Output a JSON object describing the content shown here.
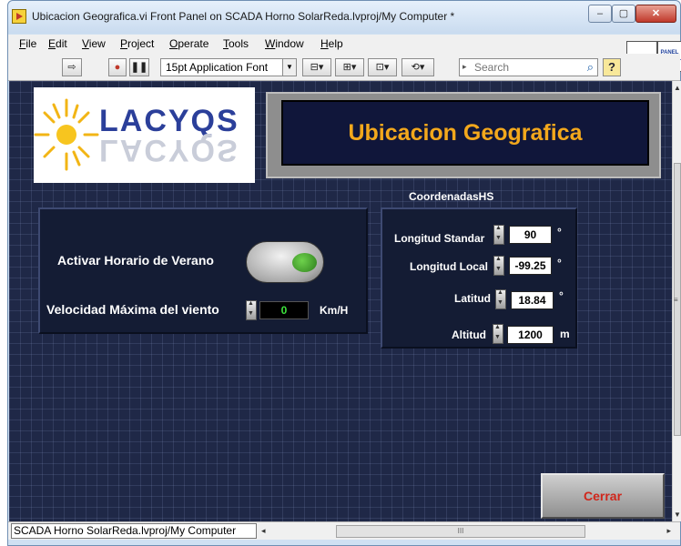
{
  "window": {
    "title": "Ubicacion Geografica.vi Front Panel on SCADA Horno SolarReda.lvproj/My Computer *",
    "controls": {
      "minimize": "–",
      "maximize": "▢",
      "close": "✕"
    }
  },
  "menu": {
    "items": [
      {
        "label": "File"
      },
      {
        "label": "Edit"
      },
      {
        "label": "View"
      },
      {
        "label": "Project"
      },
      {
        "label": "Operate"
      },
      {
        "label": "Tools"
      },
      {
        "label": "Window"
      },
      {
        "label": "Help"
      }
    ]
  },
  "toolbar": {
    "run_icon": "⇨",
    "abort_icon": "●",
    "pause_icon": "❚❚",
    "font_value": "15pt Application Font",
    "align_icon": "align-objects-icon",
    "distribute_icon": "distribute-objects-icon",
    "resize_icon": "resize-objects-icon",
    "reorder_icon": "reorder-icon",
    "search_placeholder": "Search",
    "help_label": "?",
    "panel_icon_text": "PANEL CONTRL"
  },
  "front_panel": {
    "logo_text": "LACYQS",
    "title": "Ubicacion Geografica",
    "daylight": {
      "label": "Activar Horario de Verano",
      "state": "on"
    },
    "wind": {
      "label": "Velocidad Máxima del viento",
      "value": "0",
      "unit": "Km/H"
    },
    "coords": {
      "cluster_label": "CoordenadasHS",
      "longitud_standar": {
        "label": "Longitud  Standar",
        "value": "90",
        "unit": "°"
      },
      "longitud_local": {
        "label": "Longitud  Local",
        "value": "-99.25",
        "unit": "°"
      },
      "latitud": {
        "label": "Latitud",
        "value": "18.84",
        "unit": "°"
      },
      "altitud": {
        "label": "Altitud",
        "value": "1200",
        "unit": "m"
      }
    },
    "close_button": "Cerrar"
  },
  "statusbar": {
    "path": "SCADA Horno SolarReda.lvproj/My Computer",
    "scroll_grip": "III"
  },
  "colors": {
    "panel_bg": "#1f2847",
    "title_text": "#f3a81c",
    "close_text": "#d0261b",
    "led_green": "#2d7d1c"
  }
}
